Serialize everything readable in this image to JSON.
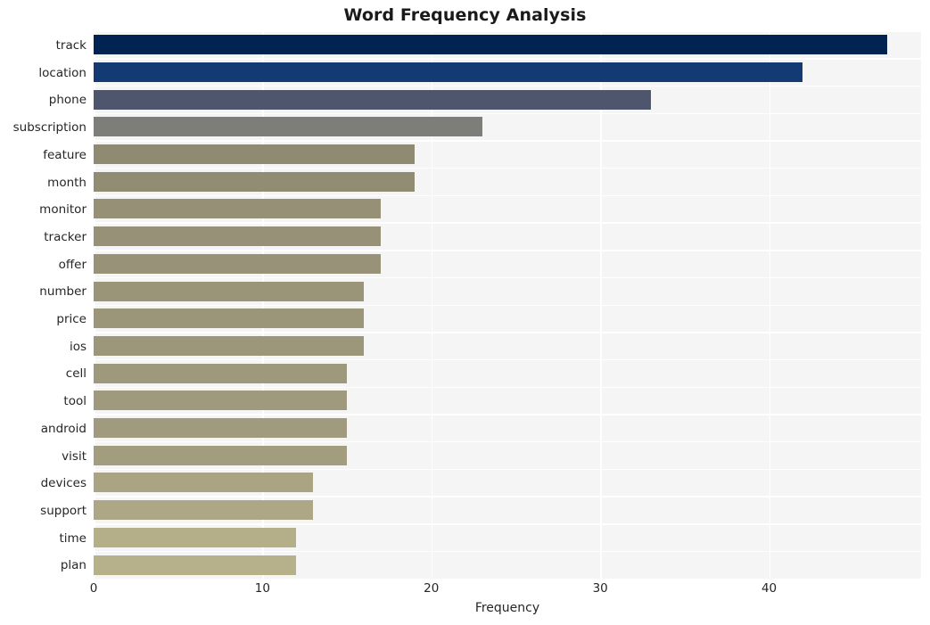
{
  "chart_data": {
    "type": "bar",
    "orientation": "horizontal",
    "title": "Word Frequency Analysis",
    "xlabel": "Frequency",
    "ylabel": "",
    "categories": [
      "track",
      "location",
      "phone",
      "subscription",
      "feature",
      "month",
      "monitor",
      "tracker",
      "offer",
      "number",
      "price",
      "ios",
      "cell",
      "tool",
      "android",
      "visit",
      "devices",
      "support",
      "time",
      "plan"
    ],
    "values": [
      47,
      42,
      33,
      23,
      19,
      19,
      17,
      17,
      17,
      16,
      16,
      16,
      15,
      15,
      15,
      15,
      13,
      13,
      12,
      12
    ],
    "xticks": [
      0,
      10,
      20,
      30,
      40
    ],
    "xtick_labels": [
      "0",
      "10",
      "20",
      "30",
      "40"
    ],
    "xlim": [
      0,
      49
    ],
    "grid": true,
    "grid_color": "#ffffff",
    "plot_background": "#f5f5f5",
    "figure_background": "#ffffff",
    "legend": null,
    "bar_colors": [
      "#012352",
      "#133a72",
      "#4e566d",
      "#7d7d79",
      "#8f8b73",
      "#918d73",
      "#969176",
      "#979277",
      "#989378",
      "#9a9579",
      "#9b967a",
      "#9c977b",
      "#9e997c",
      "#9f9a7d",
      "#a09b7e",
      "#a29d7f",
      "#aaa483",
      "#ada785",
      "#b4ae89",
      "#b6b08b"
    ]
  }
}
